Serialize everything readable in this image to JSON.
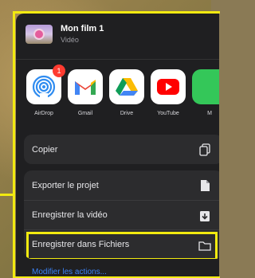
{
  "header": {
    "title": "Mon film 1",
    "subtitle": "Vidéo"
  },
  "apps": [
    {
      "label": "AirDrop",
      "icon": "airdrop-icon",
      "badge": "1"
    },
    {
      "label": "Gmail",
      "icon": "gmail-icon"
    },
    {
      "label": "Drive",
      "icon": "drive-icon"
    },
    {
      "label": "YouTube",
      "icon": "youtube-icon"
    },
    {
      "label": "M",
      "icon": "messages-icon"
    }
  ],
  "actions": {
    "copy": {
      "label": "Copier",
      "icon": "copy-icon"
    },
    "export": {
      "label": "Exporter le projet",
      "icon": "document-icon"
    },
    "save_video": {
      "label": "Enregistrer la vidéo",
      "icon": "save-download-icon"
    },
    "save_files": {
      "label": "Enregistrer dans Fichiers",
      "icon": "folder-icon"
    }
  },
  "footer": {
    "modify_label": "Modifier les actions..."
  },
  "colors": {
    "highlight": "#f2ea10",
    "sheet_bg": "#1f1f21",
    "row_bg": "#2c2c2e",
    "link": "#3b82f6"
  }
}
